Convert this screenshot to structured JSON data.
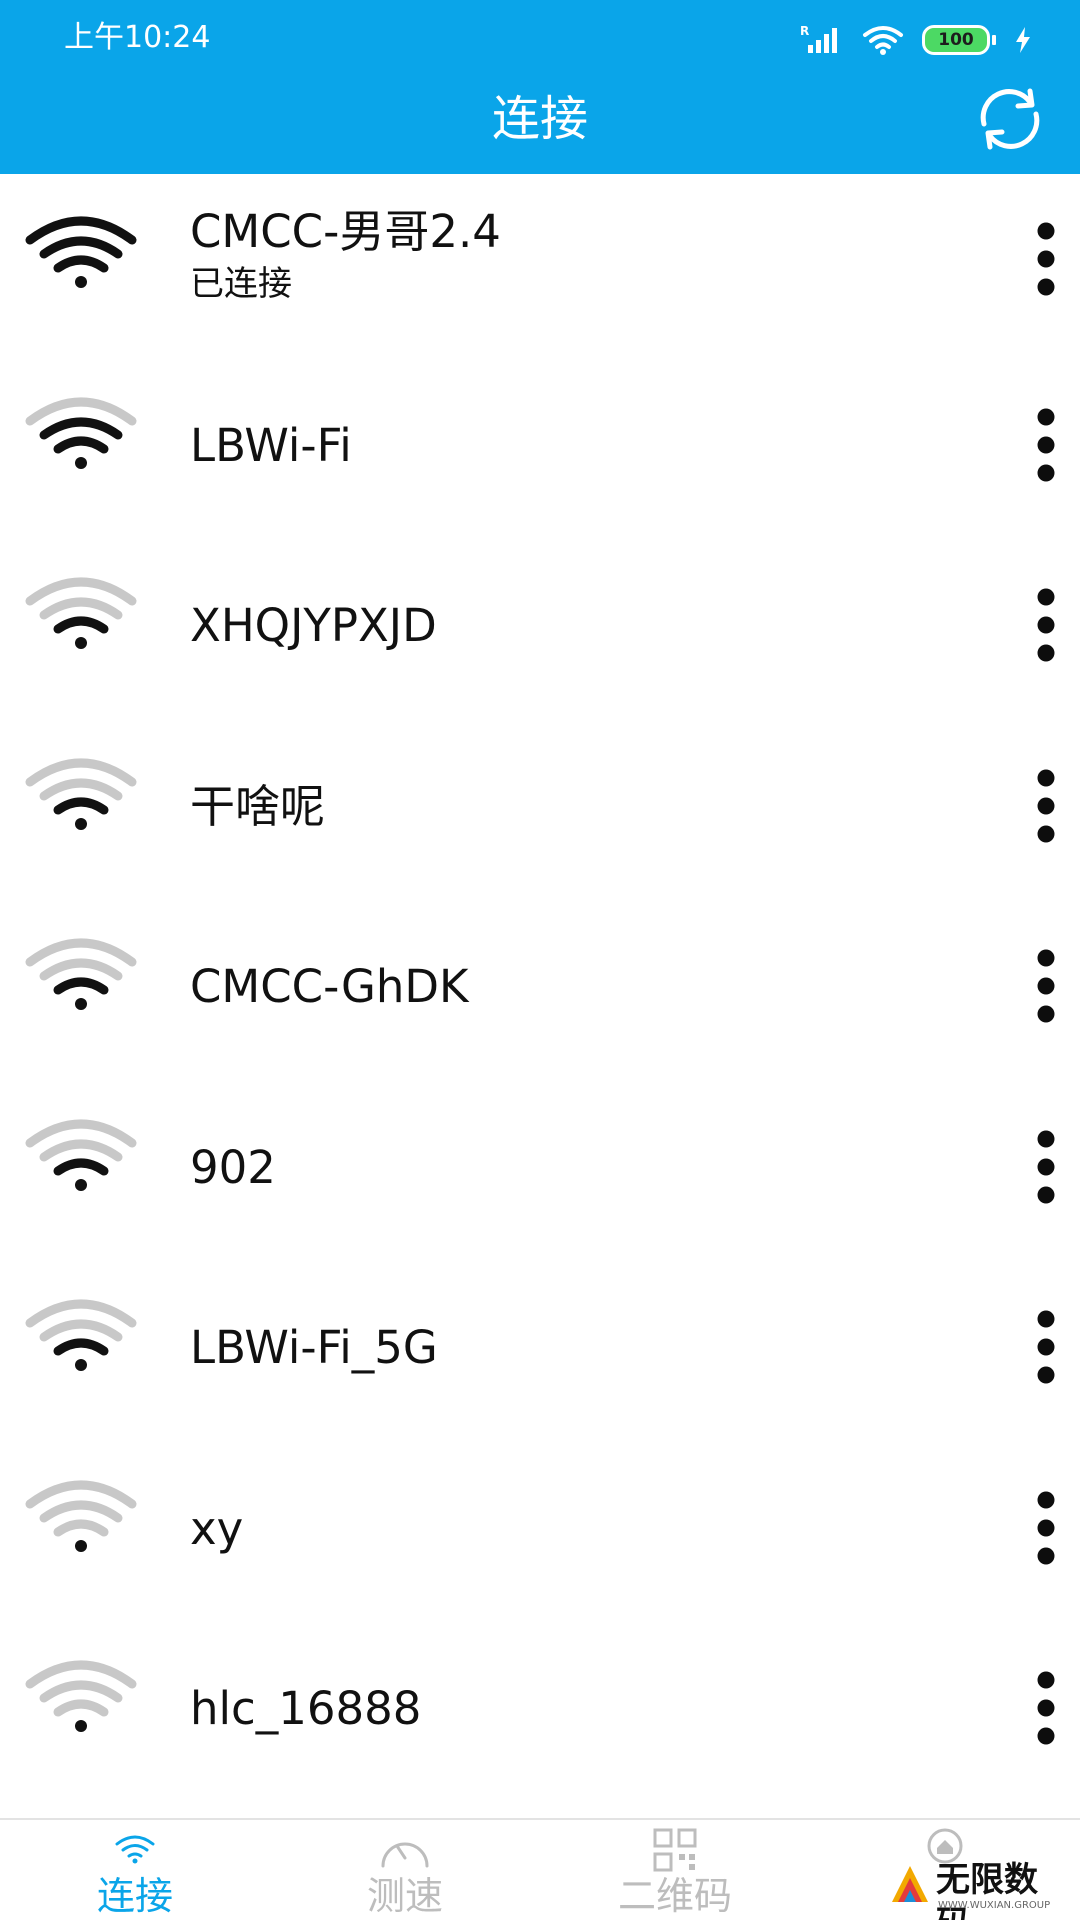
{
  "status_bar": {
    "time": "上午10:24",
    "battery": "100",
    "signal_indicator": "R"
  },
  "header": {
    "title": "连接",
    "refresh_icon": "refresh-icon"
  },
  "networks": [
    {
      "ssid": "CMCC-男哥2.4",
      "status": "已连接",
      "signal_bars": 4
    },
    {
      "ssid": "LBWi-Fi",
      "status": "",
      "signal_bars": 3
    },
    {
      "ssid": "XHQJYPXJD",
      "status": "",
      "signal_bars": 2
    },
    {
      "ssid": "干啥呢",
      "status": "",
      "signal_bars": 2
    },
    {
      "ssid": "CMCC-GhDK",
      "status": "",
      "signal_bars": 2
    },
    {
      "ssid": "902",
      "status": "",
      "signal_bars": 2
    },
    {
      "ssid": "LBWi-Fi_5G",
      "status": "",
      "signal_bars": 2
    },
    {
      "ssid": "xy",
      "status": "",
      "signal_bars": 1
    },
    {
      "ssid": "hlc_16888",
      "status": "",
      "signal_bars": 1
    }
  ],
  "bottom_nav": [
    {
      "label": "连接",
      "icon": "wifi-icon",
      "active": true
    },
    {
      "label": "测速",
      "icon": "speedometer-icon",
      "active": false
    },
    {
      "label": "二维码",
      "icon": "qr-code-icon",
      "active": false
    },
    {
      "label": "",
      "icon": "home-icon",
      "active": false
    }
  ],
  "watermark": {
    "text": "无限数码",
    "subtext": "WWW.WUXIAN.GROUP"
  },
  "colors": {
    "primary": "#0aa5e9",
    "active_wave": "#111111",
    "inactive_wave": "#c8c8c8",
    "battery": "#4cd964"
  }
}
